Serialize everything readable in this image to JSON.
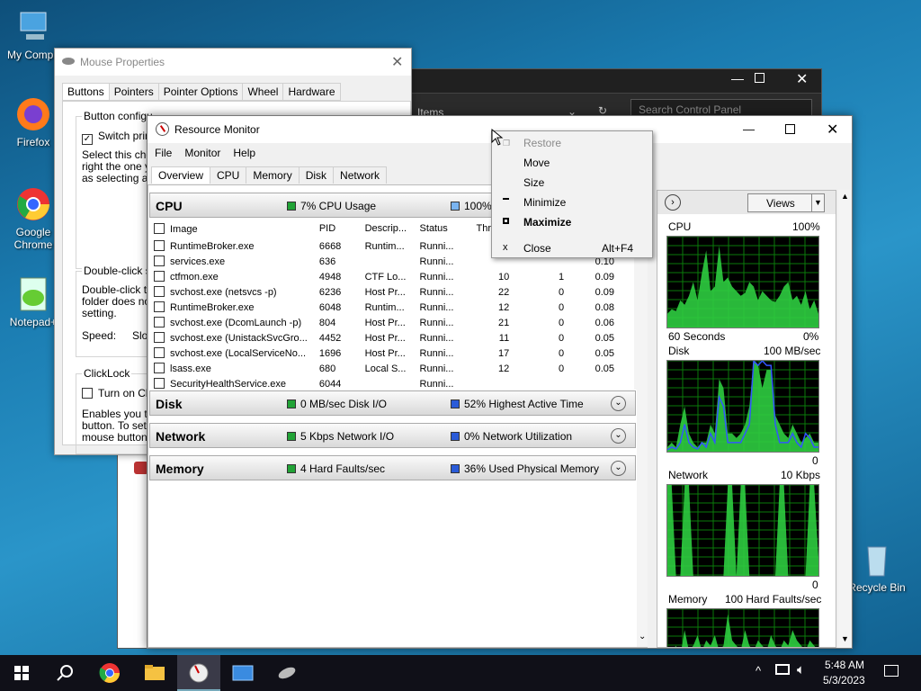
{
  "desktop": {
    "icons": [
      "My Compu",
      "Firefox",
      "Google Chrome",
      "Notepad+",
      "Recycle Bin"
    ]
  },
  "control_panel": {
    "search_placeholder": "Search Control Panel",
    "items_label": "Items"
  },
  "mouse_props": {
    "title": "Mouse Properties",
    "tabs": [
      "Buttons",
      "Pointers",
      "Pointer Options",
      "Wheel",
      "Hardware"
    ],
    "button_config": "Button configu",
    "switch_primary": "Switch prima",
    "select_text": [
      "Select this chec",
      "right the one yo",
      "as selecting and"
    ],
    "double_click": "Double-click sp",
    "double_text": [
      "Double-click the",
      "folder does not",
      "setting."
    ],
    "speed_label": "Speed:",
    "speed_slow": "Slow",
    "clicklock": "ClickLock",
    "turn_on": "Turn on Click",
    "enables_text": [
      "Enables you to",
      "button. To set, l",
      "mouse button a"
    ]
  },
  "resmon": {
    "title": "Resource Monitor",
    "menu": [
      "File",
      "Monitor",
      "Help"
    ],
    "tabs": [
      "Overview",
      "CPU",
      "Memory",
      "Disk",
      "Network"
    ],
    "cpu": {
      "name": "CPU",
      "m1": "7% CPU Usage",
      "m2": "100%"
    },
    "columns": [
      "Image",
      "PID",
      "Descrip...",
      "Status",
      "Thre",
      "",
      ""
    ],
    "rows": [
      [
        "RuntimeBroker.exe",
        "6668",
        "Runtim...",
        "Runni...",
        "11",
        "",
        "0.10"
      ],
      [
        "services.exe",
        "636",
        "",
        "Runni...",
        "",
        "",
        "0.10"
      ],
      [
        "ctfmon.exe",
        "4948",
        "CTF Lo...",
        "Runni...",
        "10",
        "1",
        "0.09"
      ],
      [
        "svchost.exe (netsvcs -p)",
        "6236",
        "Host Pr...",
        "Runni...",
        "22",
        "0",
        "0.09"
      ],
      [
        "RuntimeBroker.exe",
        "6048",
        "Runtim...",
        "Runni...",
        "12",
        "0",
        "0.08"
      ],
      [
        "svchost.exe (DcomLaunch -p)",
        "804",
        "Host Pr...",
        "Runni...",
        "21",
        "0",
        "0.06"
      ],
      [
        "svchost.exe (UnistackSvcGro...",
        "4452",
        "Host Pr...",
        "Runni...",
        "11",
        "0",
        "0.05"
      ],
      [
        "svchost.exe (LocalServiceNo...",
        "1696",
        "Host Pr...",
        "Runni...",
        "17",
        "0",
        "0.05"
      ],
      [
        "lsass.exe",
        "680",
        "Local S...",
        "Runni...",
        "12",
        "0",
        "0.05"
      ],
      [
        "SecurityHealthService.exe",
        "6044",
        "",
        "Runni...",
        "",
        "",
        ""
      ]
    ],
    "disk": {
      "name": "Disk",
      "m1": "0 MB/sec Disk I/O",
      "m2": "52% Highest Active Time"
    },
    "network": {
      "name": "Network",
      "m1": "5 Kbps Network I/O",
      "m2": "0% Network Utilization"
    },
    "memory": {
      "name": "Memory",
      "m1": "4 Hard Faults/sec",
      "m2": "36% Used Physical Memory"
    },
    "views": "Views",
    "graphs": {
      "cpu": {
        "label": "CPU",
        "max": "100%",
        "foot_l": "60 Seconds",
        "foot_r": "0%"
      },
      "disk": {
        "label": "Disk",
        "max": "100 MB/sec",
        "foot_r": "0"
      },
      "network": {
        "label": "Network",
        "max": "10 Kbps",
        "foot_r": "0"
      },
      "memory": {
        "label": "Memory",
        "max": "100 Hard Faults/sec"
      }
    }
  },
  "context_menu": {
    "items": [
      "Restore",
      "Move",
      "Size",
      "Minimize",
      "Maximize",
      "Close"
    ],
    "shortcut": "Alt+F4"
  },
  "taskbar": {
    "time": "5:48 AM",
    "date": "5/3/2023"
  },
  "colors": {
    "graph_green": "#2ecc40",
    "graph_blue": "#3355ff",
    "grid": "#0a7a0a"
  }
}
